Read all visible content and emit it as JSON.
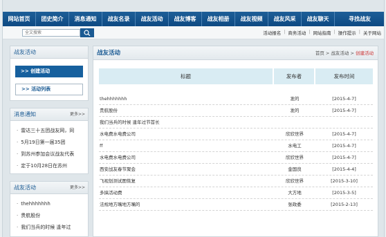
{
  "nav": [
    "网站首页",
    "团史简介",
    "消息通知",
    "战友名录",
    "战友活动",
    "战友博客",
    "战友相册",
    "战友视频",
    "战友风采",
    "战友聊天",
    "寻找战友"
  ],
  "search": {
    "placeholder": "全文搜索"
  },
  "sublinks": [
    "活动报名",
    "商务活动",
    "网站指南",
    "操作提示",
    "关于网站"
  ],
  "sidebar": {
    "activity_panel": {
      "title": "战友活动",
      "create_label": ">>  创建活动",
      "list_label": ">>  活动列表"
    },
    "notices": {
      "title": "消息通知",
      "more": "更多>>",
      "items": [
        "雷达三十五团战友网，同",
        "5月19日第一届35团",
        "到苏州参加会议战友代表",
        "定于10月28日在苏州"
      ]
    },
    "activities": {
      "title": "战友活动",
      "more": "更多>>",
      "items": [
        "thehhhhhhh",
        "贵航股份",
        "我们当兵的时候 逢年过"
      ]
    }
  },
  "main": {
    "title": "战友活动",
    "breadcrumb": {
      "home": "首页",
      "sep1": " > ",
      "section": "战友活动",
      "sep2": " > ",
      "current": "创建活动"
    },
    "columns": {
      "title": "标题",
      "publisher": "发布者",
      "time": "发布时间"
    },
    "rows": [
      {
        "title": "thehhhhhhh",
        "publisher": "发的",
        "time": "[2015-4-7]"
      },
      {
        "title": "贵航股份",
        "publisher": "发的",
        "time": "[2015-4-7]"
      },
      {
        "title": "我们当兵的时候 逢年过节首长",
        "publisher": "",
        "time": ""
      },
      {
        "title": "水电费水电费公司",
        "publisher": "欣欣世界",
        "time": "[2015-4-7]"
      },
      {
        "title": "ff",
        "publisher": "水电工",
        "time": "[2015-4-7]"
      },
      {
        "title": "水电费水电费公司",
        "publisher": "欣欣世界",
        "time": "[2015-4-7]"
      },
      {
        "title": "西安战友春节聚会",
        "publisher": "金国良",
        "time": "[2015-4-4]"
      },
      {
        "title": "飞视划测试图恢复",
        "publisher": "欣欣世界",
        "time": "[2015-3-10]"
      },
      {
        "title": "多搞活动费",
        "publisher": "大方地",
        "time": "[2015-3-5]"
      },
      {
        "title": "法规地方嘴地方嘴的",
        "publisher": "张政委",
        "time": "[2015-2-13]"
      }
    ]
  },
  "colors": {
    "nav_bg": "#0e4a83",
    "accent": "#1a5a93",
    "table_header": "#d9ecf3",
    "breadcrumb_current": "#cc3333"
  }
}
